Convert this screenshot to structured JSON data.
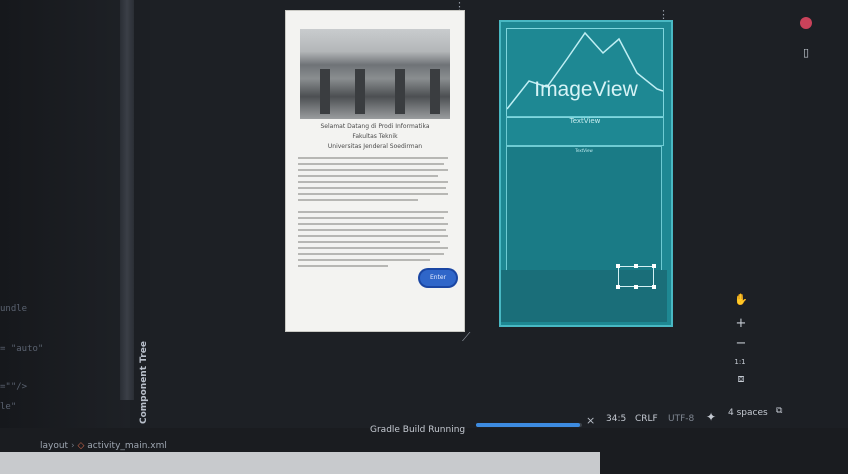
{
  "left_panel": {
    "code_fragments": [
      "undle",
      "= \"auto\"",
      "=\"\"/>",
      "le\""
    ],
    "component_tree_label": "Component Tree"
  },
  "design_preview": {
    "title_lines": [
      "Selamat Datang di Prodi Informatika",
      "Fakultas Teknik",
      "Universitas Jenderal Soedirman"
    ],
    "button_label": "Enter"
  },
  "blueprint": {
    "image_view_label": "ImageView",
    "text_view_label": "TextView",
    "scroll_label": "TextView"
  },
  "toolbar": {
    "icons": [
      "hand-icon",
      "zoom-in-icon",
      "zoom-out-icon",
      "one-to-one-icon",
      "fit-screen-icon"
    ],
    "zoom_in": "+",
    "zoom_out": "−",
    "one_to_one": "1:1"
  },
  "status_bar": {
    "build_label": "Gradle Build Running",
    "progress": 0.98,
    "position": "34:5",
    "line_ending": "CRLF",
    "encoding": "UTF-8",
    "indent": "4 spaces"
  },
  "breadcrumb": {
    "items": [
      "layout",
      "activity_main.xml"
    ]
  },
  "colors": {
    "accent": "#3d8be0",
    "blueprint": "#1e8893"
  }
}
